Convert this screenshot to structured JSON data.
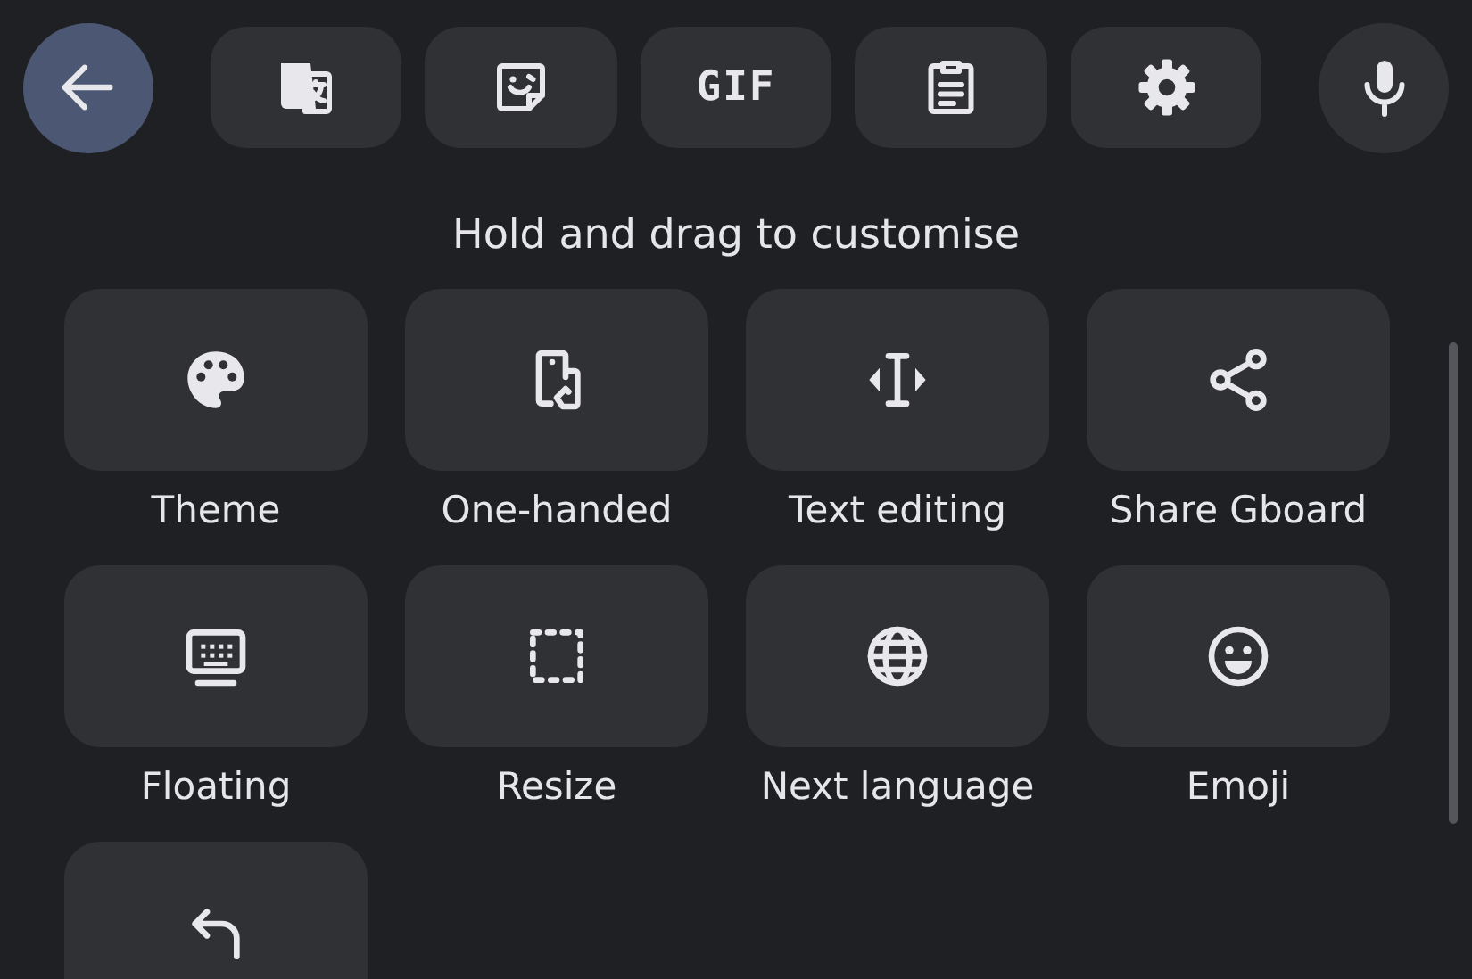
{
  "toolbar": [
    {
      "kind": "back",
      "selected": true
    },
    {
      "kind": "translate",
      "selected": false
    },
    {
      "kind": "sticker",
      "selected": false
    },
    {
      "kind": "gif",
      "label": "GIF",
      "selected": false
    },
    {
      "kind": "clipboard",
      "selected": false
    },
    {
      "kind": "settings",
      "selected": false
    },
    {
      "kind": "mic",
      "selected": false
    }
  ],
  "heading": "Hold and drag to customise",
  "tiles": [
    {
      "kind": "theme",
      "label": "Theme"
    },
    {
      "kind": "one-handed",
      "label": "One-handed"
    },
    {
      "kind": "text-editing",
      "label": "Text editing"
    },
    {
      "kind": "share",
      "label": "Share Gboard"
    },
    {
      "kind": "floating",
      "label": "Floating"
    },
    {
      "kind": "resize",
      "label": "Resize"
    },
    {
      "kind": "language",
      "label": "Next language"
    },
    {
      "kind": "emoji",
      "label": "Emoji"
    },
    {
      "kind": "undo"
    }
  ]
}
